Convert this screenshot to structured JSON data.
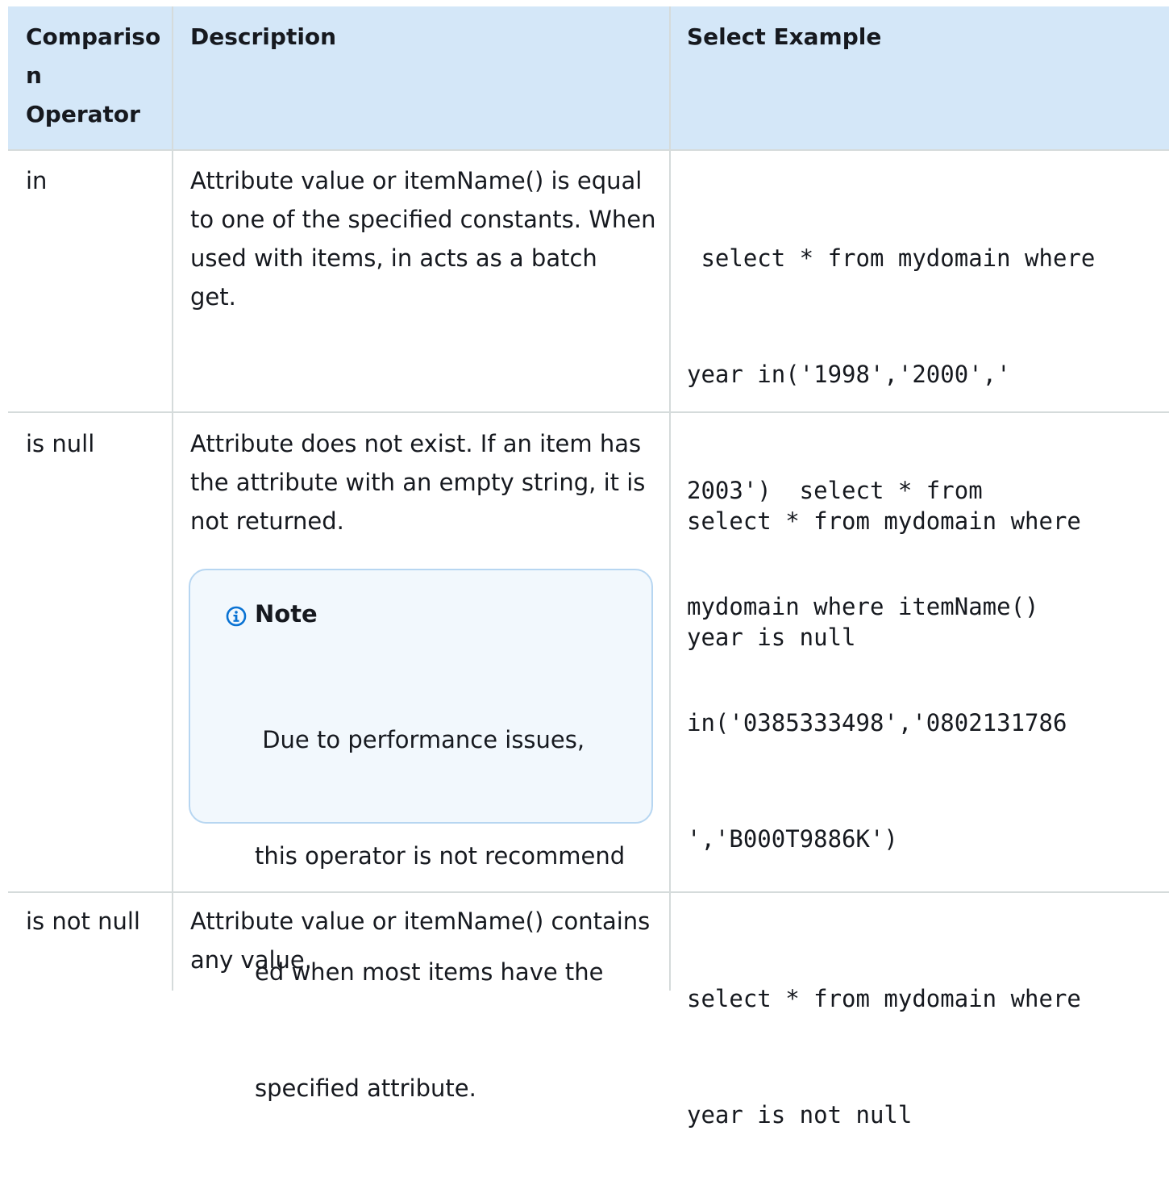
{
  "header": {
    "col1_lines": [
      "Compariso",
      "n",
      "Operator"
    ],
    "col2": "Description",
    "col3": "Select Example"
  },
  "rows": [
    {
      "operator": "in",
      "description_lines": [
        "Attribute value or itemName() is equal",
        "to one of the specified constants. When",
        "used with items,  in acts as a batch",
        "get."
      ],
      "example_lines": [
        " select * from mydomain where",
        "year in('1998','2000','",
        "2003')  select * from",
        "mydomain where itemName()",
        "in('0385333498','0802131786",
        "','B000T9886K')"
      ]
    },
    {
      "operator": "is null",
      "description_lines": [
        "Attribute does not exist. If an item has",
        "the attribute with an empty string, it is",
        "not returned."
      ],
      "note": {
        "title": "Note",
        "body_lines": [
          " Due to performance issues,",
          "this operator is not recommend",
          "ed when most items have the",
          "specified attribute."
        ]
      },
      "example_lines": [
        "select * from mydomain where",
        "year is null"
      ]
    },
    {
      "operator": "is not null",
      "description_lines": [
        "Attribute value or itemName() contains",
        "any value."
      ],
      "example_lines": [
        "select * from mydomain where",
        "year is not null"
      ]
    }
  ],
  "colors": {
    "header_bg": "#d4e7f8",
    "grid": "#d5dbdb",
    "note_border": "#b7d6f1",
    "note_bg": "#f2f8fd",
    "info_icon": "#0972d3"
  }
}
